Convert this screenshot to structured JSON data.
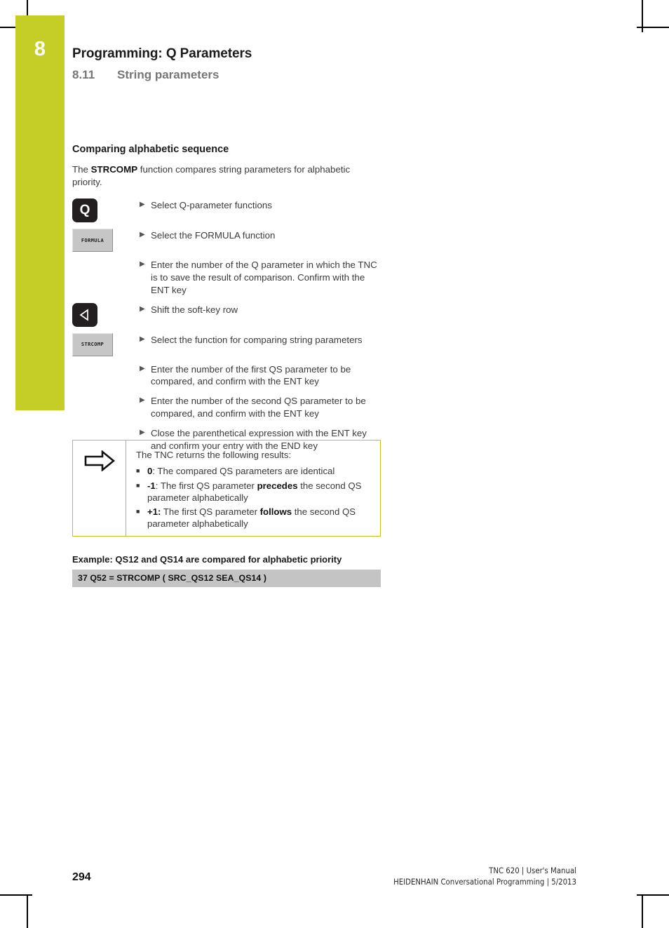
{
  "header": {
    "chapter_number": "8",
    "chapter_title": "Programming: Q Parameters",
    "section_number": "8.11",
    "section_title": "String parameters"
  },
  "content": {
    "sub_heading": "Comparing alphabetic sequence",
    "intro_prefix": "The ",
    "intro_bold": "STRCOMP",
    "intro_suffix": " function compares string parameters for alphabetic priority.",
    "steps": [
      {
        "key_type": "hardkey-letter",
        "key_label": "Q",
        "key_icon": "q-key-icon",
        "text": "Select Q-parameter functions"
      },
      {
        "key_type": "softkey",
        "key_label": "FORMULA",
        "key_icon": "formula-softkey-icon",
        "text": "Select the FORMULA function"
      },
      {
        "key_type": "none",
        "key_label": "",
        "key_icon": "",
        "text": "Enter the number of the Q parameter in which the TNC is to save the result of comparison. Confirm with the ENT key"
      },
      {
        "key_type": "hardkey-arrow",
        "key_label": "",
        "key_icon": "left-triangle-key-icon",
        "text": "Shift the soft-key row"
      },
      {
        "key_type": "softkey",
        "key_label": "STRCOMP",
        "key_icon": "strcomp-softkey-icon",
        "text": "Select the function for comparing string parameters"
      },
      {
        "key_type": "none",
        "key_label": "",
        "key_icon": "",
        "text": "Enter the number of the first QS parameter to be compared, and confirm with the ENT key"
      },
      {
        "key_type": "none",
        "key_label": "",
        "key_icon": "",
        "text": "Enter the number of the second QS parameter to be compared, and confirm with the ENT key"
      },
      {
        "key_type": "none",
        "key_label": "",
        "key_icon": "",
        "text": "Close the parenthetical expression with the ENT key and confirm your entry with the END key"
      }
    ]
  },
  "note": {
    "icon": "arrow-right-outline-icon",
    "lead": "The TNC returns the following results:",
    "items": [
      {
        "value": "0",
        "pre": ": The compared QS parameters are identical",
        "bold": "",
        "post": ""
      },
      {
        "value": "-1",
        "pre": ": The first QS parameter ",
        "bold": "precedes",
        "post": " the second QS parameter alphabetically"
      },
      {
        "value": "+1:",
        "pre": " The first QS parameter ",
        "bold": "follows",
        "post": " the second QS parameter alphabetically"
      }
    ]
  },
  "example": {
    "title": "Example: QS12 and QS14 are compared for alphabetic priority",
    "code": "37 Q52 = STRCOMP ( SRC_QS12 SEA_QS14 )"
  },
  "footer": {
    "page_number": "294",
    "line1": "TNC 620 | User's Manual",
    "line2": "HEIDENHAIN Conversational Programming | 5/2013"
  },
  "colors": {
    "chapter_accent": "#c4ce26",
    "note_border": "#c8c018",
    "code_background": "#c4c4c4",
    "softkey_face": "#c6c6c6",
    "hardkey_face": "#231f20"
  }
}
